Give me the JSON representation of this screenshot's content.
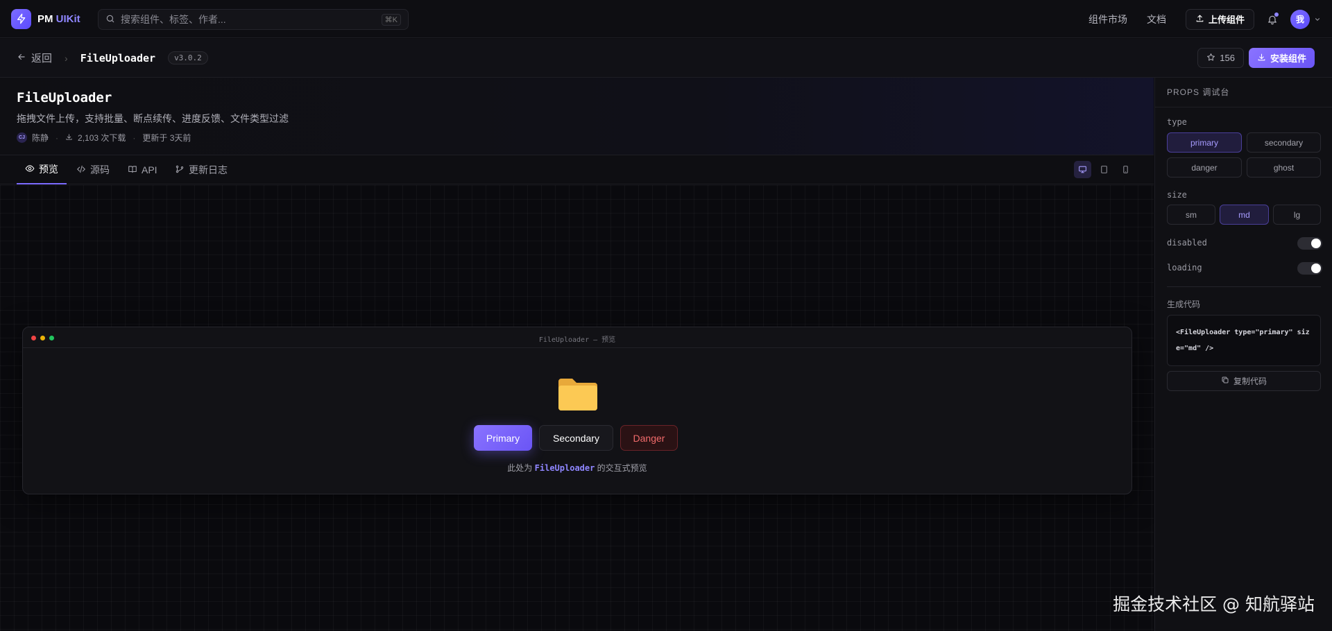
{
  "brand": {
    "name": "PM",
    "accent": "UIKit"
  },
  "search": {
    "placeholder": "搜索组件、标签、作者...",
    "shortcut": "⌘K"
  },
  "nav": {
    "links": [
      "组件市场",
      "文档"
    ],
    "upload_label": "上传组件",
    "avatar_label": "我"
  },
  "subbar": {
    "back_label": "返回",
    "component_name": "FileUploader",
    "version": "v3.0.2",
    "stars": "156",
    "install_label": "安装组件"
  },
  "info": {
    "title": "FileUploader",
    "description": "拖拽文件上传，支持批量、断点续传、进度反馈、文件类型过滤",
    "author_initials": "CJ",
    "author": "陈静",
    "downloads": "2,103 次下载",
    "updated": "更新于 3天前"
  },
  "tabs": [
    "预览",
    "源码",
    "API",
    "更新日志"
  ],
  "preview": {
    "window_title": "FileUploader — 预览",
    "buttons": {
      "primary": "Primary",
      "secondary": "Secondary",
      "danger": "Danger"
    },
    "caption_before": "此处为 ",
    "caption_highlight": "FileUploader",
    "caption_after": " 的交互式预览"
  },
  "panel": {
    "title": "PROPS 调试台",
    "type_label": "type",
    "type_options": [
      "primary",
      "secondary",
      "danger",
      "ghost"
    ],
    "type_selected": "primary",
    "size_label": "size",
    "size_options": [
      "sm",
      "md",
      "lg"
    ],
    "size_selected": "md",
    "disabled_label": "disabled",
    "loading_label": "loading",
    "code_label": "生成代码",
    "code": "<FileUploader type=\"primary\" size=\"md\" />",
    "copy_label": "复制代码"
  },
  "watermark": "掘金技术社区 @ 知航驿站",
  "colors": {
    "accent": "#7c6cff",
    "danger": "#f26b6b",
    "background": "#0b0b0f"
  }
}
